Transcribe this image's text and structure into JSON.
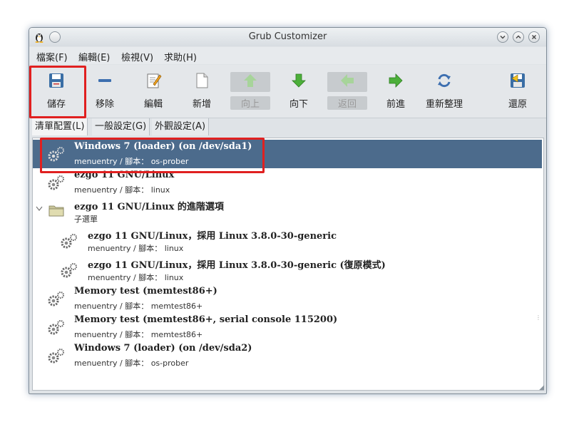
{
  "window": {
    "title": "Grub Customizer",
    "app_icon": "tux-penguin-icon",
    "controls": [
      "minimize",
      "maximize",
      "close"
    ]
  },
  "menubar": [
    {
      "label": "檔案(F)"
    },
    {
      "label": "編輯(E)"
    },
    {
      "label": "檢視(V)"
    },
    {
      "label": "求助(H)"
    }
  ],
  "toolbar": [
    {
      "label": "儲存",
      "icon": "save-icon",
      "enabled": true,
      "highlighted": true
    },
    {
      "label": "移除",
      "icon": "remove-icon",
      "enabled": true
    },
    {
      "label": "編輯",
      "icon": "edit-icon",
      "enabled": true
    },
    {
      "label": "新增",
      "icon": "new-icon",
      "enabled": true
    },
    {
      "label": "向上",
      "icon": "up-arrow-icon",
      "enabled": false
    },
    {
      "label": "向下",
      "icon": "down-arrow-icon",
      "enabled": true
    },
    {
      "label": "返回",
      "icon": "back-arrow-icon",
      "enabled": false
    },
    {
      "label": "前進",
      "icon": "forward-arrow-icon",
      "enabled": true
    },
    {
      "label": "重新整理",
      "icon": "refresh-icon",
      "enabled": true
    },
    {
      "label": "還原",
      "icon": "revert-icon",
      "enabled": true
    }
  ],
  "tabs": [
    {
      "label": "清單配置(L)",
      "active": true
    },
    {
      "label": "一般設定(G)",
      "active": false
    },
    {
      "label": "外觀設定(A)",
      "active": false
    }
  ],
  "entries": [
    {
      "title": "Windows 7 (loader) (on /dev/sda1)",
      "subtitle": "menuentry / 腳本： os-prober",
      "icon": "gear-icon",
      "selected": true,
      "highlighted": true
    },
    {
      "title": "ezgo 11 GNU/Linux",
      "subtitle": "menuentry / 腳本： linux",
      "icon": "gear-icon"
    },
    {
      "title": "ezgo 11 GNU/Linux 的進階選項",
      "subtitle": "子選單",
      "icon": "folder-icon",
      "expanded": true
    },
    {
      "title": "ezgo 11 GNU/Linux，採用 Linux 3.8.0-30-generic",
      "subtitle": "menuentry / 腳本： linux",
      "icon": "gear-icon",
      "indent": true
    },
    {
      "title": "ezgo 11 GNU/Linux，採用 Linux 3.8.0-30-generic (復原模式)",
      "subtitle": "menuentry / 腳本： linux",
      "icon": "gear-icon",
      "indent": true
    },
    {
      "title": "Memory test (memtest86+)",
      "subtitle": "menuentry / 腳本： memtest86+",
      "icon": "gear-icon"
    },
    {
      "title": "Memory test (memtest86+, serial console 115200)",
      "subtitle": "menuentry / 腳本： memtest86+",
      "icon": "gear-icon"
    },
    {
      "title": "Windows 7 (loader) (on /dev/sda2)",
      "subtitle": "menuentry / 腳本： os-prober",
      "icon": "gear-icon"
    }
  ],
  "colors": {
    "selection": "#4c6b8c",
    "highlight_box": "#e02020"
  }
}
